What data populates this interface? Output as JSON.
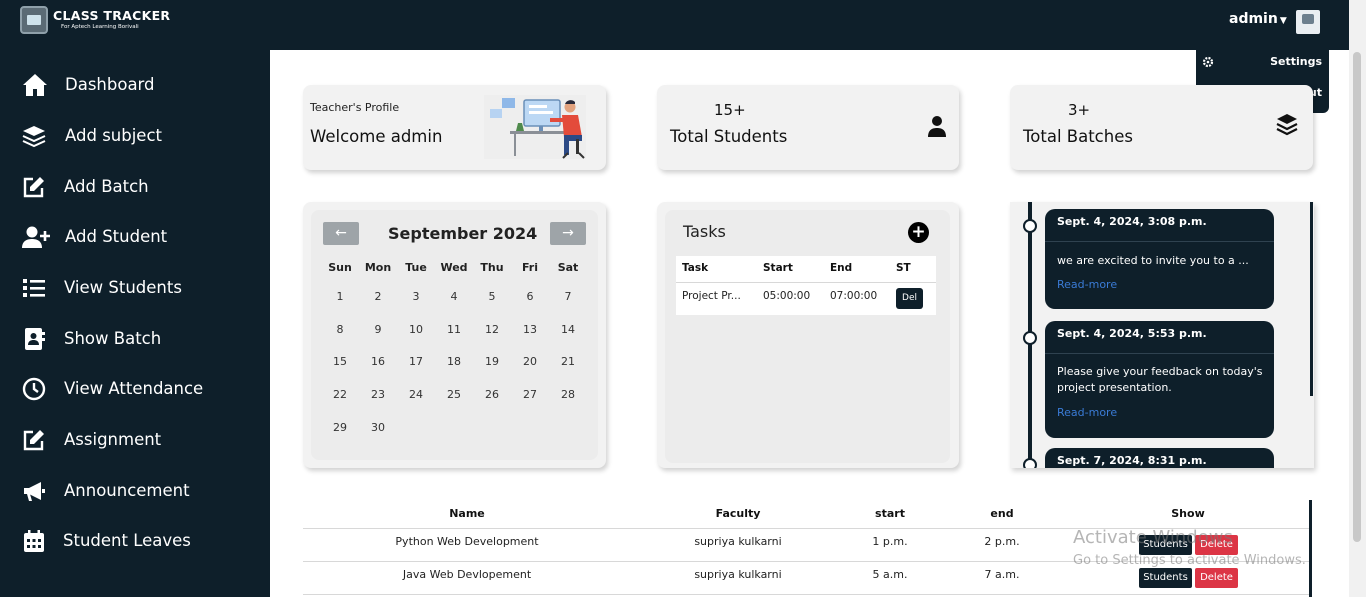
{
  "app": {
    "logo_title": "CLASS TRACKER",
    "logo_subtitle": "For Aptech Learning Borivali",
    "user": "admin",
    "brand_color": "#0e1f2a"
  },
  "user_menu": {
    "settings": "Settings",
    "logout": "Logout"
  },
  "sidebar": {
    "items": [
      {
        "label": "Dashboard",
        "icon": "home-icon"
      },
      {
        "label": "Add subject",
        "icon": "layers-icon"
      },
      {
        "label": "Add Batch",
        "icon": "edit-icon"
      },
      {
        "label": "Add Student",
        "icon": "user-plus-icon"
      },
      {
        "label": "View Students",
        "icon": "list-icon"
      },
      {
        "label": "Show Batch",
        "icon": "address-book-icon"
      },
      {
        "label": "View Attendance",
        "icon": "clock-icon"
      },
      {
        "label": "Assignment",
        "icon": "edit-icon"
      },
      {
        "label": "Announcement",
        "icon": "megaphone-icon"
      },
      {
        "label": "Student Leaves",
        "icon": "calendar-icon"
      }
    ]
  },
  "profile": {
    "caption": "Teacher's Profile",
    "welcome": "Welcome admin"
  },
  "stats": {
    "students_count": "15+",
    "students_label": "Total Students",
    "batches_count": "3+",
    "batches_label": "Total Batches"
  },
  "calendar": {
    "prev": "←",
    "next": "→",
    "title": "September 2024",
    "weekdays": [
      "Sun",
      "Mon",
      "Tue",
      "Wed",
      "Thu",
      "Fri",
      "Sat"
    ],
    "weeks": [
      [
        "1",
        "2",
        "3",
        "4",
        "5",
        "6",
        "7"
      ],
      [
        "8",
        "9",
        "10",
        "11",
        "12",
        "13",
        "14"
      ],
      [
        "15",
        "16",
        "17",
        "18",
        "19",
        "20",
        "21"
      ],
      [
        "22",
        "23",
        "24",
        "25",
        "26",
        "27",
        "28"
      ],
      [
        "29",
        "30"
      ]
    ]
  },
  "tasks": {
    "title": "Tasks",
    "add": "+",
    "headers": [
      "Task",
      "Start",
      "End",
      "ST"
    ],
    "rows": [
      {
        "task": "Project Pr...",
        "start": "05:00:00",
        "end": "07:00:00",
        "action": "Del"
      }
    ]
  },
  "announcements": [
    {
      "date": "Sept. 4, 2024, 3:08 p.m.",
      "message": "we are excited to invite you to a ...",
      "link": "Read-more"
    },
    {
      "date": "Sept. 4, 2024, 5:53 p.m.",
      "message": "Please give your feedback on today's project presentation.",
      "link": "Read-more"
    },
    {
      "date": "Sept. 7, 2024, 8:31 p.m."
    }
  ],
  "batches": {
    "headers": [
      "Name",
      "Faculty",
      "start",
      "end",
      "Show"
    ],
    "rows": [
      {
        "name": "Python Web Development",
        "faculty": "supriya kulkarni",
        "start": "1 p.m.",
        "end": "2 p.m."
      },
      {
        "name": "Java Web Devlopement",
        "faculty": "supriya kulkarni",
        "start": "5 a.m.",
        "end": "7 a.m."
      }
    ],
    "students_button": "Students",
    "delete_button": "Delete"
  },
  "watermark": {
    "line1": "Activate Windows",
    "line2": "Go to Settings to activate Windows."
  }
}
